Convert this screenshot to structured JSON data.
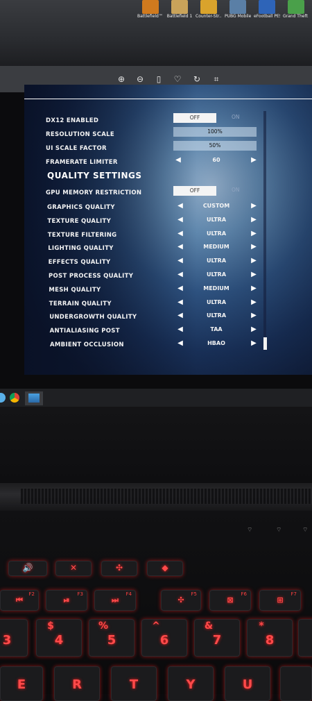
{
  "desktop_icons": [
    {
      "label": "Battlefield™ V",
      "color": "#d07a1e"
    },
    {
      "label": "Battlefield 1",
      "color": "#c9a35a"
    },
    {
      "label": "Counter-Str... Global Offe...",
      "color": "#d9a32c"
    },
    {
      "label": "PUBG Mobile",
      "color": "#5a7fa6"
    },
    {
      "label": "eFootball PES 2021 SEASO...",
      "color": "#2e64b8"
    },
    {
      "label": "Grand Theft Auto V",
      "color": "#4aa04a"
    }
  ],
  "viewer_toolbar": [
    "zoom-in-icon",
    "zoom-out-icon",
    "delete-icon",
    "favorite-icon",
    "rotate-icon",
    "crop-icon"
  ],
  "settings": {
    "dx12": {
      "label": "DX12 ENABLED",
      "value": "OFF",
      "alt": "ON"
    },
    "resolution_scale": {
      "label": "RESOLUTION SCALE",
      "value": "100%"
    },
    "ui_scale": {
      "label": "UI SCALE FACTOR",
      "value": "50%"
    },
    "framerate": {
      "label": "FRAMERATE LIMITER",
      "value": "60"
    },
    "section_title": "QUALITY SETTINGS",
    "gpu_mem": {
      "label": "GPU MEMORY RESTRICTION",
      "value": "OFF",
      "alt": "ON"
    },
    "quality_rows": [
      {
        "label": "GRAPHICS QUALITY",
        "value": "CUSTOM"
      },
      {
        "label": "TEXTURE QUALITY",
        "value": "ULTRA"
      },
      {
        "label": "TEXTURE FILTERING",
        "value": "ULTRA"
      },
      {
        "label": "LIGHTING QUALITY",
        "value": "MEDIUM"
      },
      {
        "label": "EFFECTS QUALITY",
        "value": "ULTRA"
      },
      {
        "label": "POST PROCESS QUALITY",
        "value": "ULTRA"
      },
      {
        "label": "MESH QUALITY",
        "value": "MEDIUM"
      },
      {
        "label": "TERRAIN QUALITY",
        "value": "ULTRA"
      },
      {
        "label": "UNDERGROWTH QUALITY",
        "value": "ULTRA"
      },
      {
        "label": "ANTIALIASING POST",
        "value": "TAA"
      },
      {
        "label": "AMBIENT OCCLUSION",
        "value": "HBAO"
      }
    ]
  },
  "keys": {
    "f2": "F2",
    "f3": "F3",
    "f4": "F4",
    "f5": "F5",
    "f6": "F6",
    "f7": "F7",
    "k3": "3",
    "k4": "4",
    "k5": "5",
    "k6": "6",
    "k7": "7",
    "k8": "8",
    "k4_top": "$",
    "k5_top": "%",
    "k6_top": "^",
    "k7_top": "&",
    "k8_top": "*",
    "e": "E",
    "r": "R",
    "t": "T",
    "y": "Y",
    "u": "U"
  }
}
